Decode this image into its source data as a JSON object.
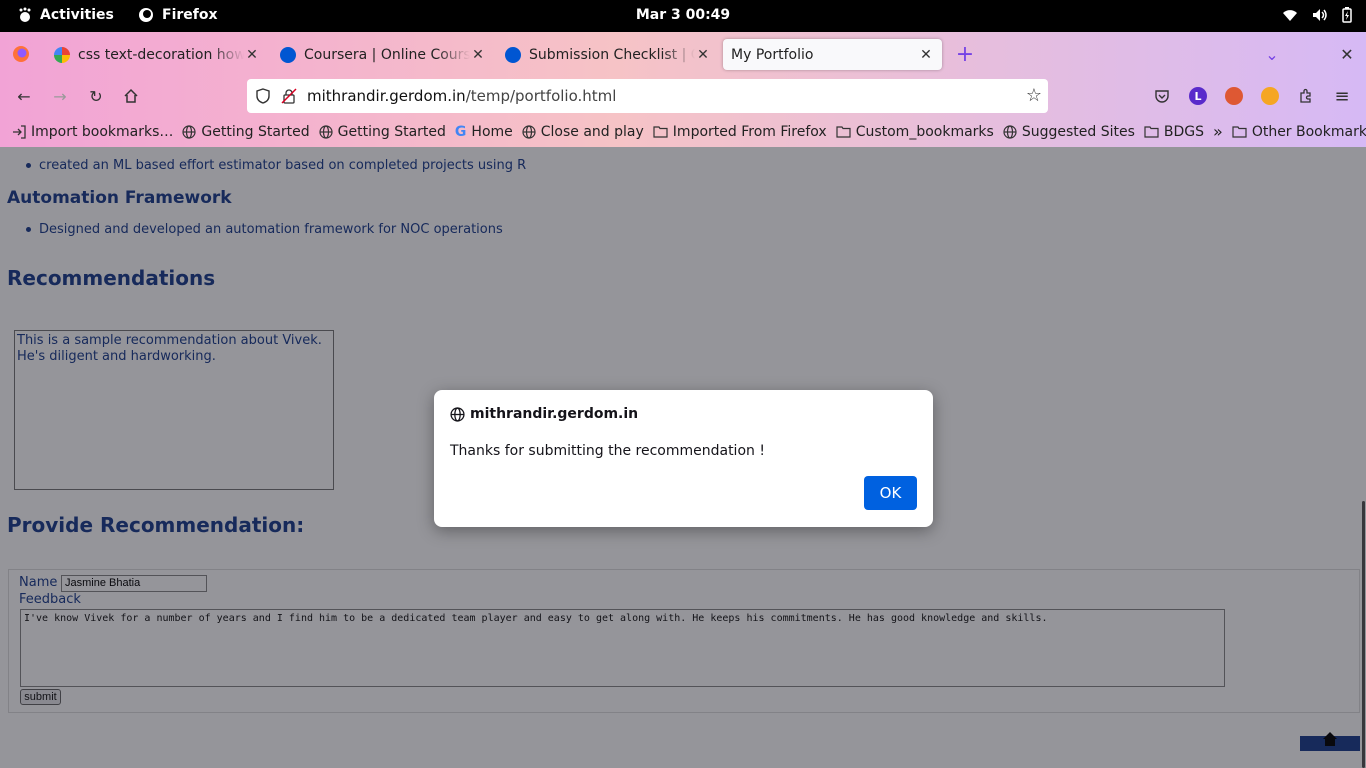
{
  "system": {
    "activities": "Activities",
    "app_name": "Firefox",
    "clock": "Mar 3  00:49"
  },
  "tabs": [
    {
      "title": "css text-decoration how t",
      "favicon_color": "#4285f4"
    },
    {
      "title": "Coursera | Online Courses",
      "favicon_color": "#0056d2"
    },
    {
      "title": "Submission Checklist | Co",
      "favicon_color": "#0056d2"
    },
    {
      "title": "My Portfolio",
      "active": true
    }
  ],
  "url": {
    "host": "mithrandir.gerdom.in",
    "path": "/temp/portfolio.html"
  },
  "bookmarks": [
    {
      "label": "Import bookmarks…",
      "icon": "import-icon"
    },
    {
      "label": "Getting Started",
      "icon": "globe-icon"
    },
    {
      "label": "Getting Started",
      "icon": "globe-icon"
    },
    {
      "label": "Home",
      "icon": "google-icon"
    },
    {
      "label": "Close and play",
      "icon": "globe-icon"
    },
    {
      "label": "Imported From Firefox",
      "icon": "folder-icon"
    },
    {
      "label": "Custom_bookmarks",
      "icon": "folder-icon"
    },
    {
      "label": "Suggested Sites",
      "icon": "globe-icon"
    },
    {
      "label": "BDGS",
      "icon": "folder-icon"
    },
    {
      "label": "Other Bookmarks",
      "icon": "folder-icon"
    }
  ],
  "page": {
    "bullet1": "created an ML based effort estimator based on completed projects using R",
    "section_automation": "Automation Framework",
    "bullet2": "Designed and developed an automation framework for NOC operations",
    "recommendations_heading": "Recommendations",
    "recommendation_text": "This is a sample recommendation about Vivek. He's diligent and hardworking.",
    "provide_heading": "Provide Recommendation:",
    "form": {
      "name_label": "Name",
      "name_value": "Jasmine Bhatia",
      "feedback_label": "Feedback",
      "feedback_value": "I've know Vivek for a number of years and I find him to be a dedicated team player and easy to get along with. He keeps his commitments. He has good knowledge and skills.",
      "submit_label": "submit"
    }
  },
  "dialog": {
    "origin": "mithrandir.gerdom.in",
    "message": "Thanks for submitting the recommendation !",
    "ok_label": "OK"
  },
  "colors": {
    "accent": "#0061e0",
    "page_text": "#1a3c8c"
  }
}
